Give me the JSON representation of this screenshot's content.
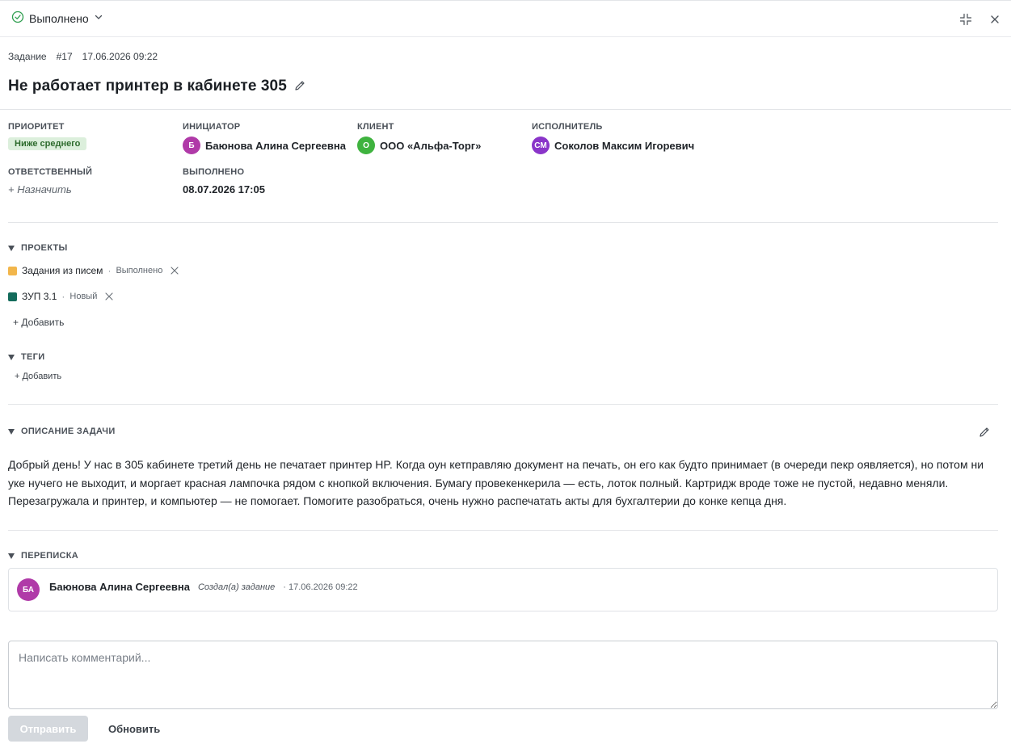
{
  "header": {
    "status_label": "Выполнено",
    "status_color": "#2e9e4f"
  },
  "task": {
    "type_label": "Задание",
    "number": "#17",
    "created": "17.06.2026 09:22",
    "title": "Не работает принтер в кабинете 305"
  },
  "fields": {
    "priority": {
      "label": "ПРИОРИТЕТ",
      "value": "Ниже среднего"
    },
    "initiator": {
      "label": "ИНИЦИАТОР",
      "initials": "Б",
      "name": "Баюнова Алина Сергеевна",
      "color": "#b03aa8"
    },
    "client": {
      "label": "КЛИЕНТ",
      "initials": "О",
      "name": "ООО «Альфа-Торг»",
      "color": "#3fb33f"
    },
    "executor": {
      "label": "ИСПОЛНИТЕЛЬ",
      "initials": "СМ",
      "name": "Соколов Максим Игоревич",
      "color": "#8a35c9"
    },
    "responsible": {
      "label": "ОТВЕТСТВЕННЫЙ",
      "value": "+ Назначить"
    },
    "completed": {
      "label": "ВЫПОЛНЕНО",
      "value": "08.07.2026 17:05"
    }
  },
  "projects": {
    "title": "ПРОЕКТЫ",
    "items": [
      {
        "name": "Задания из писем",
        "status": "Выполнено",
        "color": "#f2b64b"
      },
      {
        "name": "ЗУП 3.1",
        "status": "Новый",
        "color": "#136b5b"
      }
    ],
    "add_label": "+ Добавить"
  },
  "tags": {
    "title": "ТЕГИ",
    "add_label": "+ Добавить"
  },
  "description": {
    "title": "ОПИСАНИЕ ЗАДАЧИ",
    "text": "Добрый день! У нас в 305 кабинете третий день не печатает принтер HP. Когда оун кетправляю документ на печать, он его как будто принимает (в очереди пекр оявляется), но потом ни уке нучего не выходит, и моргает красная лампочка рядом с кнопкой включения. Бумагу провекенкерила — есть, лоток полный. Картридж вроде тоже не пустой, недавно меняли. Перезагружала и принтер, и компьютер — не помогает. Помогите разобраться, очень нужно распечатать акты для бухгалтерии до конке кепца дня."
  },
  "correspondence": {
    "title": "ПЕРЕПИСКА",
    "entries": [
      {
        "initials": "БА",
        "author": "Баюнова Алина Сергеевна",
        "action": "Создал(а) задание",
        "time": "· 17.06.2026 09:22",
        "color": "#b03aa8"
      }
    ]
  },
  "comment": {
    "placeholder": "Написать комментарий...",
    "send_label": "Отправить",
    "refresh_label": "Обновить"
  }
}
